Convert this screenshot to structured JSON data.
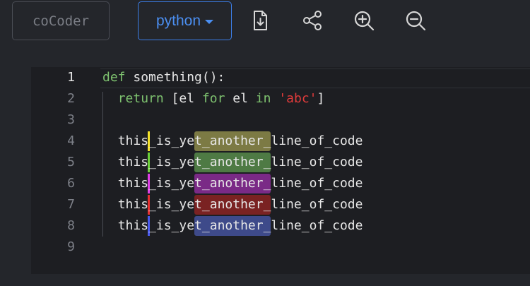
{
  "toolbar": {
    "brand": "coCoder",
    "language": "python",
    "icons": [
      "download-file-icon",
      "share-icon",
      "zoom-in-icon",
      "zoom-out-icon"
    ]
  },
  "editor": {
    "line_numbers": [
      "1",
      "2",
      "3",
      "4",
      "5",
      "6",
      "7",
      "8",
      "9"
    ],
    "active_line": "1",
    "line1": {
      "kw": "def",
      "rest": " something():"
    },
    "line2": {
      "indent": "  ",
      "kw1": "return",
      "t1": " [el ",
      "kw2": "for",
      "t2": " el ",
      "kw3": "in",
      "t3": " ",
      "str": "'abc'",
      "t4": "]"
    },
    "repeated_line": "this_is_yet_another_line_of_code",
    "highlight_colors": [
      "#7c7a44",
      "#4e7a44",
      "#7a2a86",
      "#7a2222",
      "#3e4a8a"
    ],
    "cursor_colors": [
      "#f5e32a",
      "#6ed23a",
      "#e040e8",
      "#e83030",
      "#4a5af0"
    ],
    "colors": {
      "background": "#24262b",
      "editor": "#1d1e22",
      "accent": "#3c7ee8",
      "keyword": "#7ec26f",
      "string": "#e03b3b"
    }
  }
}
